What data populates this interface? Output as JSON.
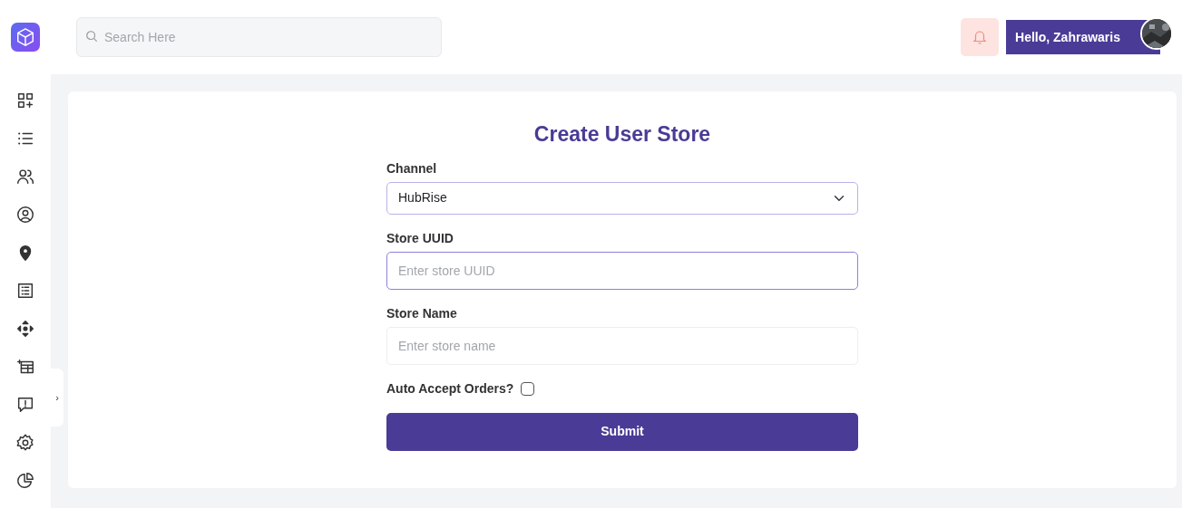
{
  "search": {
    "placeholder": "Search Here"
  },
  "user": {
    "greeting": "Hello, Zahrawaris"
  },
  "sidebar": {
    "items": [
      {
        "kind": "apps"
      },
      {
        "kind": "list"
      },
      {
        "kind": "users"
      },
      {
        "kind": "profile"
      },
      {
        "kind": "pin"
      },
      {
        "kind": "sheet"
      },
      {
        "kind": "move"
      },
      {
        "kind": "billing"
      },
      {
        "kind": "report"
      },
      {
        "kind": "settings"
      },
      {
        "kind": "chart"
      }
    ],
    "toggle": "›"
  },
  "form": {
    "title": "Create User Store",
    "fields": [
      {
        "kind": "select",
        "label": "Channel",
        "value": "HubRise",
        "focused": false
      },
      {
        "kind": "text",
        "label": "Store UUID",
        "placeholder": "Enter store UUID",
        "focused": true
      },
      {
        "kind": "text",
        "label": "Store Name",
        "placeholder": "Enter store name",
        "focused": false
      },
      {
        "kind": "checkbox",
        "label": "Auto Accept Orders?",
        "checked": false
      }
    ],
    "submit": "Submit"
  }
}
